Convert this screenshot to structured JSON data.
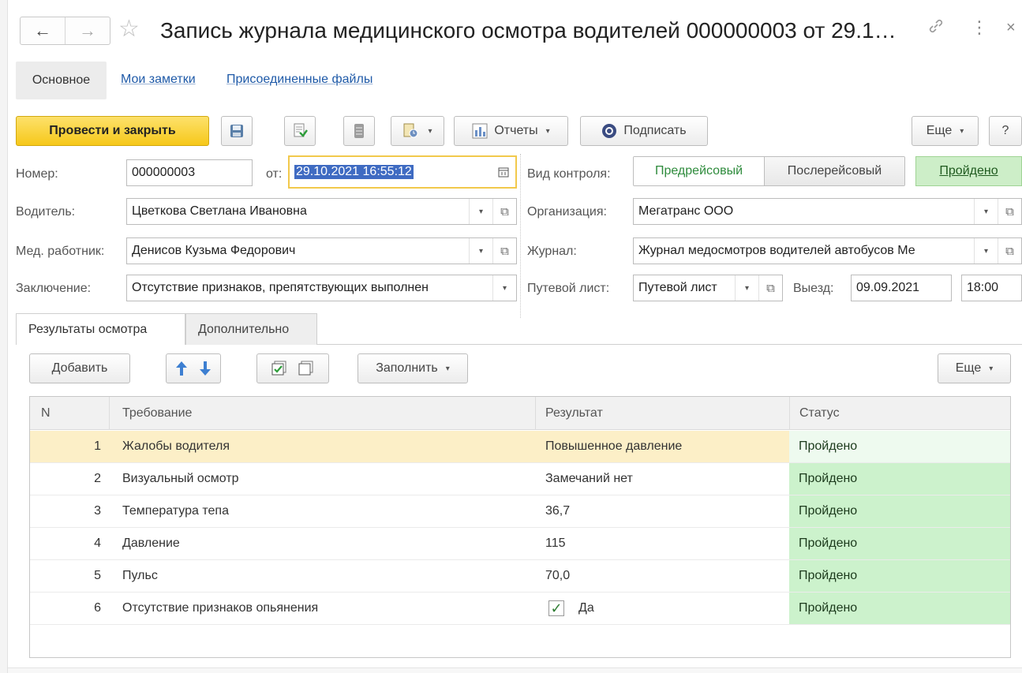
{
  "window": {
    "title": "Запись журнала медицинского осмотра водителей 000000003 от 29.1…",
    "nav_back": "←",
    "nav_forward": "→",
    "star": "☆",
    "link_icon": "🔗",
    "more_icon": "⋮",
    "close_icon": "×"
  },
  "tabs": {
    "main": "Основное",
    "notes": "Мои заметки",
    "files": "Присоединенные файлы"
  },
  "toolbar": {
    "post_close": "Провести и закрыть",
    "reports": "Отчеты",
    "sign": "Подписать",
    "more": "Еще",
    "help": "?",
    "dropdown": "▾"
  },
  "form": {
    "number_label": "Номер:",
    "number_value": "000000003",
    "date_label": "от:",
    "date_value": "29.10.2021 16:55:12",
    "driver_label": "Водитель:",
    "driver_value": "Цветкова Светлана Ивановна",
    "medic_label": "Мед. работник:",
    "medic_value": "Денисов Кузьма Федорович",
    "conclusion_label": "Заключение:",
    "conclusion_value": "Отсутствие признаков, препятствующих выполнен",
    "control_label": "Вид контроля:",
    "control_pre": "Предрейсовый",
    "control_post": "Послерейсовый",
    "passed_badge": "Пройдено",
    "org_label": "Организация:",
    "org_value": "Мегатранс ООО",
    "journal_label": "Журнал:",
    "journal_value": "Журнал медосмотров водителей автобусов Ме",
    "waybill_label": "Путевой лист:",
    "waybill_value": "Путевой лист",
    "departure_label": "Выезд:",
    "departure_date": "09.09.2021",
    "departure_time": "18:00"
  },
  "subtabs": {
    "results": "Результаты осмотра",
    "extra": "Дополнительно"
  },
  "table_toolbar": {
    "add": "Добавить",
    "fill": "Заполнить",
    "more": "Еще"
  },
  "table": {
    "headers": [
      "N",
      "Требование",
      "Результат",
      "Статус"
    ],
    "rows": [
      {
        "n": "1",
        "req": "Жалобы водителя",
        "result": "Повышенное давление",
        "status": "Пройдено"
      },
      {
        "n": "2",
        "req": "Визуальный осмотр",
        "result": "Замечаний нет",
        "status": "Пройдено"
      },
      {
        "n": "3",
        "req": "Температура тепа",
        "result": "36,7",
        "status": "Пройдено"
      },
      {
        "n": "4",
        "req": "Давление",
        "result": "115",
        "status": "Пройдено"
      },
      {
        "n": "5",
        "req": "Пульс",
        "result": "70,0",
        "status": "Пройдено"
      },
      {
        "n": "6",
        "req": "Отсутствие признаков опьянения",
        "result": "Да",
        "status": "Пройдено"
      }
    ]
  },
  "colors": {
    "primary_button": "#f6c81a",
    "status_green": "#ccf2cc",
    "selected_row": "#fcefc7",
    "link": "#1f5aa8",
    "date_focus_border": "#f2c94c"
  }
}
